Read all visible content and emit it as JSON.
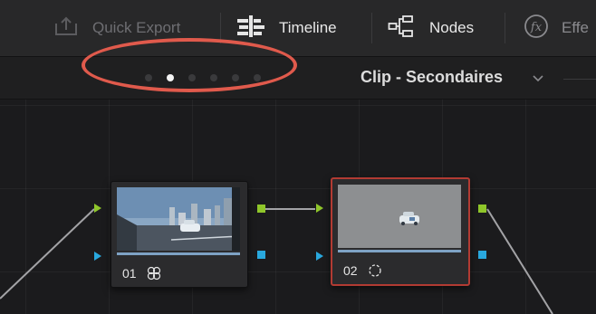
{
  "toolbar": {
    "items": [
      {
        "label": "Quick Export",
        "icon": "export-icon"
      },
      {
        "label": "Timeline",
        "icon": "timeline-icon"
      },
      {
        "label": "Nodes",
        "icon": "nodes-icon"
      },
      {
        "label": "Effe",
        "icon": "fx-icon"
      }
    ]
  },
  "subbar": {
    "page_dots": {
      "count": 6,
      "active_index": 1
    },
    "mode_title": "Clip - Secondaires",
    "mode_chevron_icon": "chevron-down-icon"
  },
  "annotation": {
    "color": "#e05a4c"
  },
  "nodes": [
    {
      "number": "01",
      "icon": "color-wheels-icon",
      "selected": false
    },
    {
      "number": "02",
      "icon": "tracker-icon",
      "selected": true
    }
  ],
  "colors": {
    "rgb_port": "#8fc62a",
    "alpha_port": "#29a8de",
    "selection": "#b23b33"
  }
}
